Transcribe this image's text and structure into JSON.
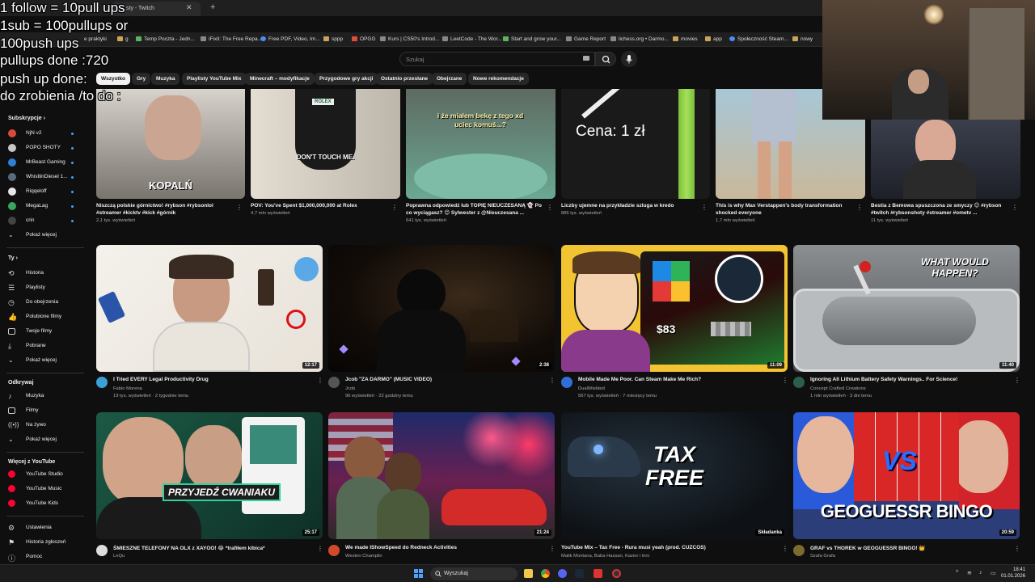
{
  "overlay": {
    "lines": [
      "1 follow = 10pull ups",
      "1sub = 100pullups or",
      "100push ups",
      "pullups done :720",
      "push up done:",
      "do zrobienia /to do :"
    ]
  },
  "browser": {
    "tab_title": "sty - Twitch",
    "bookmarks": [
      "e praktyki",
      "g",
      "Temp Poczta - Jedn...",
      "iFixit: The Free Repa...",
      "Free PDF, Video, Im...",
      "sppp",
      "OPGG",
      "Kurs | CS50's Introd...",
      "LeetCode - The Wor...",
      "Start and grow your...",
      "Game Report",
      "lichess.org • Darmo...",
      "movies",
      "app",
      "Społeczność Steam...",
      "nowy"
    ]
  },
  "header": {
    "search_placeholder": "Szukaj"
  },
  "chips": [
    "Wszystko",
    "Gry",
    "Muzyka",
    "Playlisty YouTube Mix",
    "Minecraft – modyfikacje",
    "Przygodowe gry akcji",
    "Ostatnio przesłane",
    "Obejrzane",
    "Nowe rekomendacje"
  ],
  "sidebar": {
    "subs_head": "Subskrypcje",
    "subs": [
      "NjN v2",
      "POPO SHOTY",
      "MrBeast Gaming",
      "WhistlinDiesel 1...",
      "Riqqeloff",
      "MegaLag",
      "crin"
    ],
    "show_more": "Pokaż więcej",
    "you_head": "Ty",
    "you": [
      "Historia",
      "Playlisty",
      "Do obejrzenia",
      "Polubione filmy",
      "Twoje filmy",
      "Pobrane",
      "Pokaż więcej"
    ],
    "explore_head": "Odkrywaj",
    "explore": [
      "Muzyka",
      "Filmy",
      "Na żywo",
      "Pokaż więcej"
    ],
    "more_head": "Więcej z YouTube",
    "more": [
      "YouTube Studio",
      "YouTube Music",
      "YouTube Kids"
    ],
    "bottom": [
      "Ustawienia",
      "Historia zgłoszeń",
      "Pomoc"
    ]
  },
  "shorts": [
    {
      "thumb_text": "KOPALŃ",
      "title": "Niszczą polskie górnictwo! #rybson #rybsonlol #streamer #kicktv #kick #górnik",
      "views": "2,1 tys. wyświetleń"
    },
    {
      "thumb_text": "DON'T TOUCH ME.",
      "title": "POV: You've Spent $1,000,000,000 at Rolex",
      "views": "4,7 mln wyświetleń"
    },
    {
      "thumb_text": "i że miałem bekę z tego xd uciec komuś...?",
      "title": "Poprawna odpowiedź lub TOPIĘ NIEUCZESANĄ 👻 Po co wyciągasz? 😊 Sylwester z @Nieuczesana ...",
      "views": "641 tys. wyświetleń"
    },
    {
      "thumb_text": "Cena: 1 zł",
      "title": "Liczby ujemne na przykładzie szluga w kredo",
      "views": "886 tys. wyświetleń"
    },
    {
      "thumb_text": "",
      "title": "This is why Max Verstappen's body transformation shocked everyone",
      "views": "1,7 mln wyświetleń"
    },
    {
      "thumb_text": "",
      "title": "Bestia z Bemowa spuszczona ze smyczy 😊 #rybson #twitch #rybsonshoty #streamer #ometv ...",
      "views": "11 tys. wyświetleń"
    }
  ],
  "videos": [
    {
      "title": "I Tried EVERY Legal Productivity Drug",
      "channel": "Fabio Morena",
      "stats": "19 tys. wyświetleń · 2 tygodnie temu",
      "duration": "12:17",
      "avatar_color": "#3aa0d8"
    },
    {
      "title": "Jcob \"ZA DARMO\" (MUSIC VIDEO)",
      "channel": "Jcob",
      "stats": "96 wyświetleń · 22 godziny temu",
      "duration": "2:38",
      "avatar_color": "#555555"
    },
    {
      "title": "Mobile Made Me Poor. Can Steam Make Me Rich?",
      "channel": "DualWielded",
      "stats": "567 tys. wyświetleń · 7 miesięcy temu",
      "duration": "11:09",
      "avatar_color": "#2f6fd6"
    },
    {
      "title": "Ignoring All Lithium Battery Safety Warnings.. For Science!",
      "channel": "Concept Crafted Creations",
      "stats": "1 mln wyświetleń · 3 dni temu",
      "duration": "11:40",
      "avatar_color": "#2c5e4e"
    },
    {
      "title": "ŚMIESZNE TELEFONY NA OLX z XAYOO! 😂 *trafiłem kibica*",
      "channel": "LeQu",
      "stats": "",
      "duration": "25:17",
      "avatar_color": "#dddddd"
    },
    {
      "title": "We made IShowSpeed do Redneck Activities",
      "channel": "Westen Champlin",
      "stats": "",
      "duration": "21:24",
      "avatar_color": "#d04a2a"
    },
    {
      "title": "YouTube Mix – Tax Free - Rura musi yeah (prod. CUZCOS)",
      "channel": "Malik Montana, Baba Hassan, Kazior i inni",
      "stats": "",
      "duration": "Składanka",
      "avatar_color": ""
    },
    {
      "title": "GRAF vs THOREK w GEOGUESSR BINGO! 👑",
      "channel": "Szafa Grafa",
      "stats": "",
      "duration": "20:59",
      "avatar_color": "#7d6a2e"
    }
  ],
  "thumb_texts": {
    "rolex": "ROLEX",
    "what_would": "WHAT WOULD HAPPEN?",
    "steam_price": "$83",
    "przyjedz": "PRZYJEDŹ CWANIAKU",
    "tax": "TAX FREE",
    "geo": "GEOGUESSR BINGO",
    "vs": "VS"
  },
  "taskbar": {
    "search_label": "Wyszukaj",
    "time": "18:41",
    "date": "01.01.2026"
  },
  "colors": {
    "background": "#0f0f0f",
    "chip_active": "#f1f1f1",
    "youtube_red": "#ff0033"
  }
}
